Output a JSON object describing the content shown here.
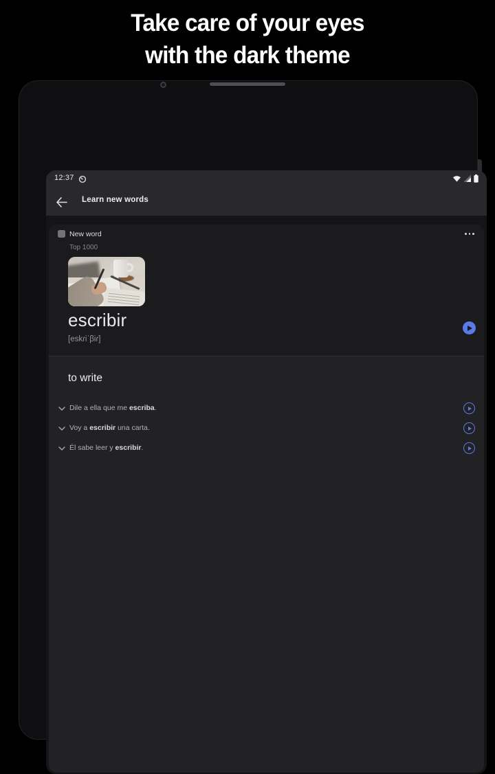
{
  "headline": {
    "line1": "Take care of your eyes",
    "line2": "with the dark theme"
  },
  "device": {
    "status_bar": {
      "time": "12:37",
      "right_icons": [
        "wifi-icon",
        "cell-signal-icon",
        "battery-icon"
      ],
      "left_icon": "notification-circle-icon"
    },
    "app_bar": {
      "title": "Learn new words",
      "back_icon": "arrow-left-icon"
    }
  },
  "card": {
    "header": {
      "label": "New word",
      "checkbox_checked": false,
      "menu_icon": "overflow-menu-icon"
    },
    "collection": "Top 1000",
    "word": "escribir",
    "transcription": "[eskɾiˈβiɾ]",
    "word_play_icon": "play-icon",
    "translation": "to write",
    "examples": [
      {
        "prefix": "Dile a ella que me ",
        "highlight": "escriba",
        "suffix": "."
      },
      {
        "prefix": "Voy a ",
        "highlight": "escribir",
        "suffix": " una carta."
      },
      {
        "prefix": "Él sabe leer y ",
        "highlight": "escribir",
        "suffix": "."
      }
    ]
  },
  "colors": {
    "accent_blue": "#5b79e8",
    "page_bg": "#000000",
    "bezel": "#0f0f11",
    "screen_bg": "#151517",
    "appbar_bg": "#29292b",
    "card_top_bg": "#1b1b1d",
    "card_bottom_bg": "#222224"
  }
}
